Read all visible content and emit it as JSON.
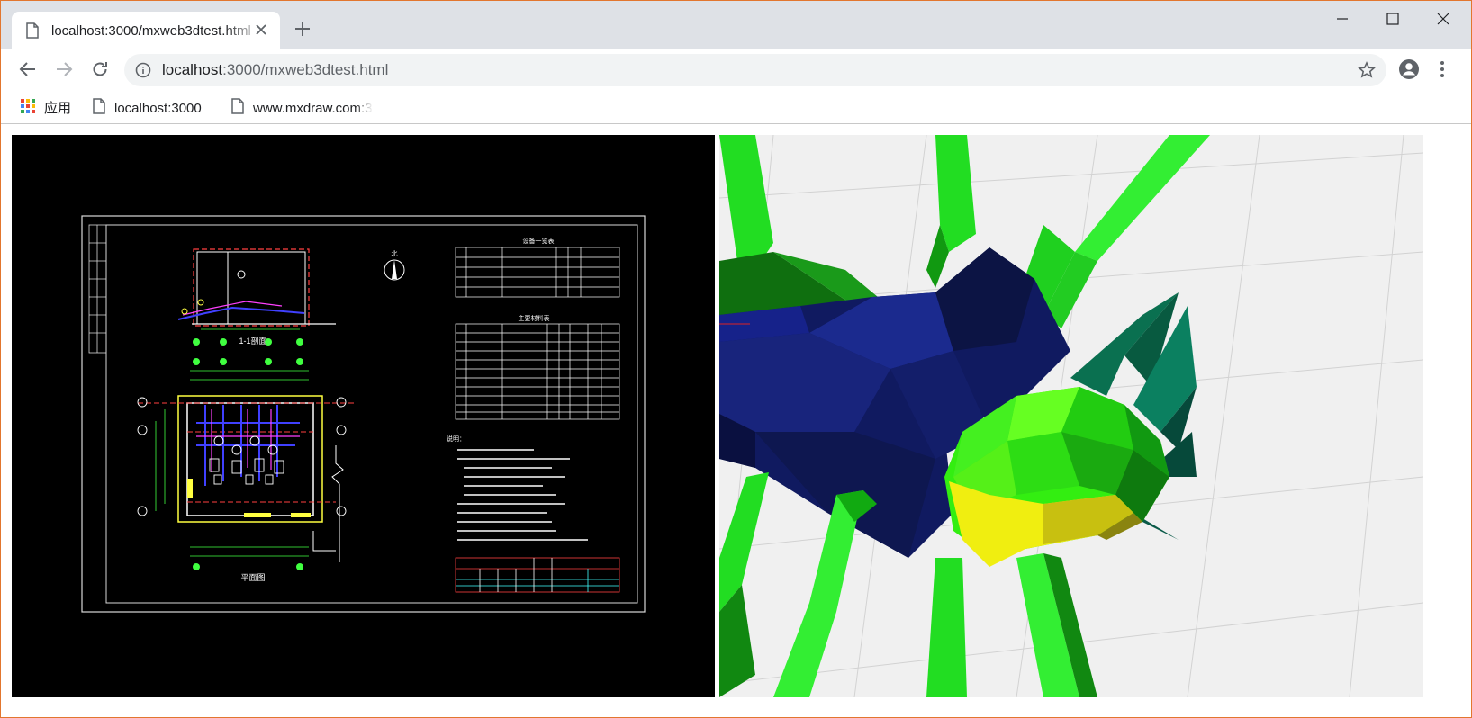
{
  "tab": {
    "title": "localhost:3000/mxweb3dtest.html"
  },
  "address": {
    "host": "localhost",
    "path": ":3000/mxweb3dtest.html"
  },
  "bookmarks": [
    {
      "label": "应用"
    },
    {
      "label": "localhost:3000"
    },
    {
      "label": "www.mxdraw.com:3"
    }
  ],
  "icons": {
    "tab_file": "file-icon",
    "tab_close": "close-icon",
    "new_tab": "plus-icon",
    "back": "back-arrow-icon",
    "forward": "forward-arrow-icon",
    "reload": "reload-icon",
    "info": "info-icon",
    "star": "star-icon",
    "account": "account-icon",
    "menu": "kebab-menu-icon",
    "apps": "apps-grid-icon"
  },
  "colors": {
    "accent": "#e2762e",
    "cad_bg": "#000000",
    "view3d_bg": "#f0f0f0"
  },
  "cad": {
    "section_title": "1-1剖面",
    "plan_title": "平面图",
    "north": "北",
    "table1_title": "设备一览表",
    "table2_title": "主要材料表",
    "notes_title": "说明："
  }
}
